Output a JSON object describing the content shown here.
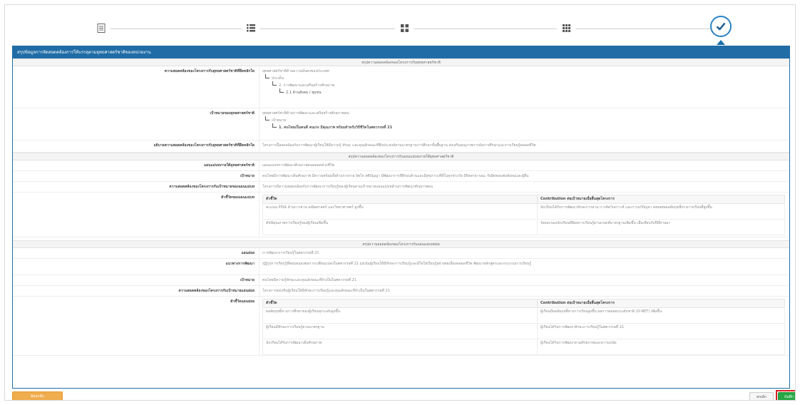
{
  "wizard": {
    "steps": [
      {
        "icon": "document-icon"
      },
      {
        "icon": "list-icon"
      },
      {
        "icon": "columns-icon"
      },
      {
        "icon": "grid-icon"
      },
      {
        "icon": "check-circle-icon",
        "state": "current"
      }
    ]
  },
  "panel": {
    "title": "สรุปข้อมูลการจัดสอดคล้องการให้บรรลุตามยุทธศาสตร์ชาติของหน่วยงาน",
    "section1": "สรุปความสอดคล้องของโครงการกับยุทธศาสตร์ชาติ",
    "row_a": {
      "label": "ความสอดคล้องของโครงการกับยุทธศาสตร์ชาติที่ยึดหลักใด",
      "lines": [
        "ยุทธศาสตร์ชาติด้านความมั่นคงของประเทศ",
        "ประเด็น",
        "2. การพัฒนาและเสริมสร้างศักยภาพ",
        "2.1 ด้านสังคม / ชุมชน"
      ]
    },
    "row_b": {
      "label": "เป้าหมายของยุทธศาสตร์ชาติ",
      "lines": [
        "ยุทธศาสตร์ชาติด้านการพัฒนาและเสริมสร้างศักยภาพคน",
        "เป้าหมาย",
        "1. คนไทยเป็นคนดี คนเก่ง มีคุณภาพ พร้อมสำหรับวิถีชีวิตในศตวรรษที่ 21"
      ]
    },
    "row_c": {
      "label": "อธิบายความสอดคล้องของโครงการกับยุทธศาสตร์ชาติที่ยึดหลักใด",
      "text": "โครงการนี้สอดคล้องกับการพัฒนาผู้เรียนให้มีความรู้ ทักษะ และคุณลักษณะที่พึงประสงค์ตามมาตรฐานการศึกษาขั้นพื้นฐาน ส่งเสริมคุณภาพการจัดการศึกษาและการเรียนรู้ตลอดชีวิต"
    },
    "section2": "สรุปความสอดคล้องของโครงการกับแผนแม่บทภายใต้ยุทธศาสตร์ชาติ",
    "row_d": {
      "label": "แผนแม่บทภายใต้ยุทธศาสตร์ชาติ",
      "text": "แผนแม่บทการพัฒนาศักยภาพคนตลอดช่วงชีวิต"
    },
    "row_e": {
      "label": "เป้าหมาย",
      "text": "คนไทยมีการพัฒนาเต็มศักยภาพ มีความพร้อมทั้งด้านร่างกาย จิตใจ สติปัญญา มีพัฒนาการที่ดีรอบด้านและมีสุขภาวะที่ดีในทุกช่วงวัย มีจิตสาธารณะ รับผิดชอบต่อสังคมและผู้อื่น"
    },
    "row_f": {
      "label": "ความสอดคล้องของโครงการกับเป้าหมายของแผนแม่บท",
      "text": "โครงการมีความสอดคล้องกับการพัฒนาการเรียนรู้ของผู้เรียนตามเป้าหมายแผนแม่บทด้านการพัฒนาศักยภาพคน"
    },
    "row_g": {
      "label": "ตัวชี้วัดของแผนแม่บท",
      "headers": [
        "ตัวชี้วัด",
        "Contribution ต่อเป้าหมายเมื่อสิ้นสุดโครงการ"
      ],
      "rows": [
        [
          "คะแนน PISA ด้านการอ่าน คณิตศาสตร์ และวิทยาศาสตร์ สูงขึ้น",
          "นักเรียนได้รับการพัฒนาทักษะการอ่าน การคิดวิเคราะห์ และการแก้ปัญหา ส่งผลต่อผลสัมฤทธิ์ทางการเรียนที่สูงขึ้น"
        ],
        [
          "ดัชนีคุณภาพการเรียนรู้ของผู้เรียนเพิ่มขึ้น",
          "ร้อยละของนักเรียนที่มีผลการเรียนรู้ผ่านเกณฑ์มาตรฐานเพิ่มขึ้น เมื่อเทียบกับปีที่ผ่านมา"
        ]
      ]
    },
    "section3": "สรุปความสอดคล้องของโครงการกับแผนแม่บทย่อย",
    "row_h": {
      "label": "แผนย่อย",
      "text": "การพัฒนาการเรียนรู้ในศตวรรษที่ 21"
    },
    "row_i": {
      "label": "แนวทางการพัฒนา",
      "text": "ปฏิรูปการเรียนรู้ที่ตอบสนองต่อการเปลี่ยนแปลงในศตวรรษที่ 21 มุ่งเน้นผู้เรียนให้มีทักษะการเรียนรู้และมีใจใฝ่เรียนรู้อย่างต่อเนื่องตลอดชีวิต พัฒนาหลักสูตรและกระบวนการเรียนรู้"
    },
    "row_j": {
      "label": "เป้าหมาย",
      "text": "คนไทยมีความรู้ทักษะและคุณลักษณะที่จำเป็นในศตวรรษที่ 21"
    },
    "row_k": {
      "label": "ความสอดคล้องของโครงการกับเป้าหมายแผนย่อย",
      "text": "โครงการส่งเสริมผู้เรียนให้มีทักษะการเรียนรู้และคุณลักษณะที่จำเป็นในศตวรรษที่ 21"
    },
    "row_l": {
      "label": "ตัวชี้วัดแผนย่อย",
      "headers": [
        "ตัวชี้วัด",
        "Contribution ต่อเป้าหมายเมื่อสิ้นสุดโครงการ"
      ],
      "rows": [
        [
          "ผลสัมฤทธิ์ทางการศึกษาของผู้เรียนทุกระดับสูงขึ้น",
          "ผู้เรียนมีผลสัมฤทธิ์ทางการเรียนสูงขึ้น ผลการทดสอบระดับชาติ (O-NET) เพิ่มขึ้น"
        ],
        [
          "ผู้เรียนมีทักษะการเรียนรู้ตามมาตรฐาน",
          "ผู้เรียนได้รับการพัฒนาทักษะการเรียนรู้ในศตวรรษที่ 21"
        ],
        [
          "นักเรียนได้รับการพัฒนาเต็มศักยภาพ",
          "ผู้เรียนได้รับการพัฒนาตามศักยภาพและความถนัด"
        ]
      ]
    }
  },
  "footer": {
    "back_label": "ย้อนกลับ",
    "cancel_label": "ยกเลิก",
    "save_label": "บันทึก"
  }
}
